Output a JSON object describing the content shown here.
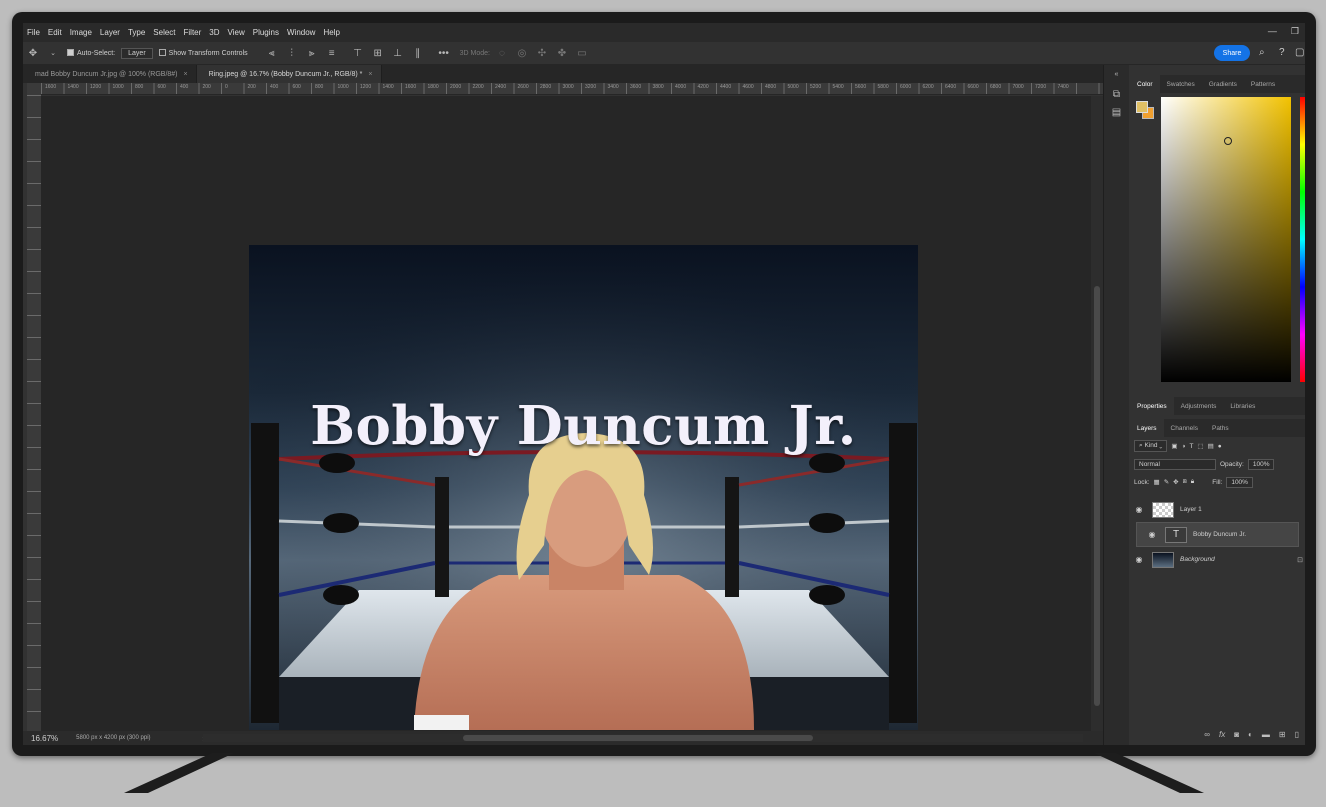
{
  "menu": [
    "File",
    "Edit",
    "Image",
    "Layer",
    "Type",
    "Select",
    "Filter",
    "3D",
    "View",
    "Plugins",
    "Window",
    "Help"
  ],
  "options": {
    "auto_select_label": "Auto-Select:",
    "auto_select_value": "Layer",
    "transform_label": "Show Transform Controls",
    "mode_3d": "3D Mode:",
    "share_label": "Share"
  },
  "tabs": [
    {
      "label": "mad Bobby Duncum Jr.jpg @ 100% (RGB/8#)",
      "close": "×"
    },
    {
      "label": "Ring.jpeg @ 16.7% (Bobby Duncum Jr., RGB/8) *",
      "close": "×"
    }
  ],
  "ruler_labels": [
    "1600",
    "1400",
    "1200",
    "1000",
    "800",
    "600",
    "400",
    "200",
    "0",
    "200",
    "400",
    "600",
    "800",
    "1000",
    "1200",
    "1400",
    "1600",
    "1800",
    "2000",
    "2200",
    "2400",
    "2600",
    "2800",
    "3000",
    "3200",
    "3400",
    "3600",
    "3800",
    "4000",
    "4200",
    "4400",
    "4600",
    "4800",
    "5000",
    "5200",
    "5400",
    "5600",
    "5800",
    "6000",
    "6200",
    "6400",
    "6600",
    "6800",
    "7000",
    "7200",
    "7400"
  ],
  "canvas": {
    "title": "Bobby Duncum Jr."
  },
  "status": {
    "zoom": "16.67%",
    "doc_info": "5800 px x 4200 px (300 ppi)",
    "arrow": "›"
  },
  "color_panel": {
    "tabs": [
      "Color",
      "Swatches",
      "Gradients",
      "Patterns"
    ],
    "fg": "#e0c065",
    "bg": "#f0a030"
  },
  "props_panel": {
    "tabs": [
      "Properties",
      "Adjustments",
      "Libraries"
    ]
  },
  "layers_panel": {
    "tabs": [
      "Layers",
      "Channels",
      "Paths"
    ],
    "filter_label": "Kind",
    "blend_mode": "Normal",
    "opacity_label": "Opacity:",
    "opacity_value": "100%",
    "lock_label": "Lock:",
    "fill_label": "Fill:",
    "fill_value": "100%",
    "layers": [
      {
        "name": "Layer 1",
        "kind": "pixel"
      },
      {
        "name": "Bobby Duncum Jr.",
        "kind": "text",
        "type_glyph": "T"
      },
      {
        "name": "Background",
        "kind": "background"
      }
    ]
  },
  "icons": {
    "move_tool": "move-icon",
    "search": "search-icon",
    "help": "help-icon",
    "workspace": "workspace-icon",
    "visibility": "eye-icon"
  }
}
